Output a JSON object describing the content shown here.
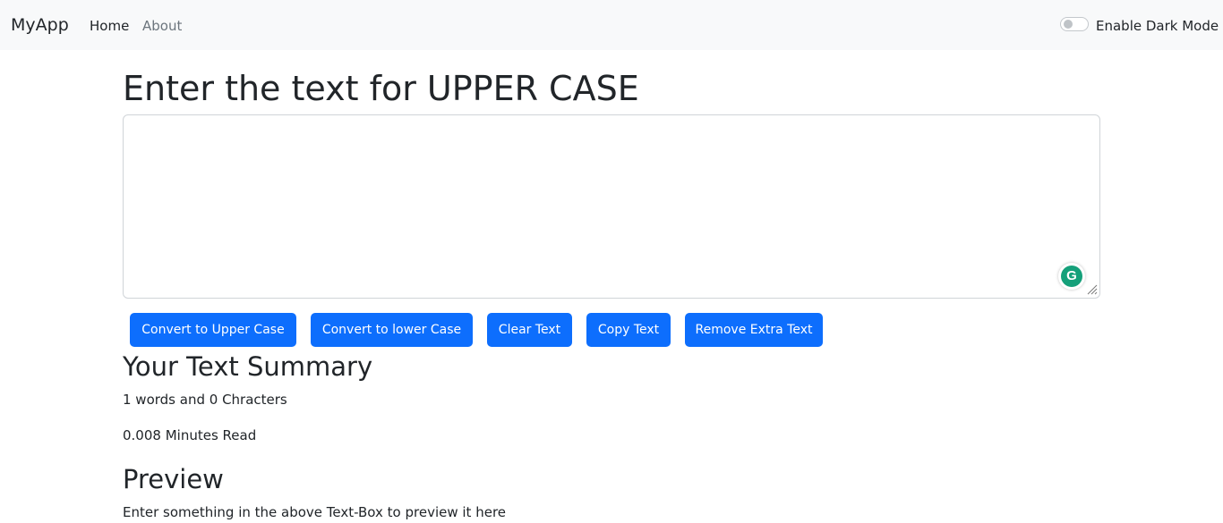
{
  "navbar": {
    "brand": "MyApp",
    "links": [
      {
        "label": "Home",
        "active": true
      },
      {
        "label": "About",
        "active": false
      }
    ],
    "dark_mode_toggle": {
      "label": "Enable Dark Mode",
      "checked": false
    }
  },
  "main": {
    "heading": "Enter the text for UPPER CASE",
    "textarea": {
      "value": "",
      "placeholder": ""
    },
    "buttons": [
      {
        "label": "Convert to Upper Case"
      },
      {
        "label": "Convert to lower Case"
      },
      {
        "label": "Clear Text"
      },
      {
        "label": "Copy Text"
      },
      {
        "label": "Remove Extra Text"
      }
    ],
    "summary": {
      "title": "Your Text Summary",
      "words_line": "1 words and 0 Chracters",
      "read_line": "0.008 Minutes Read"
    },
    "preview": {
      "title": "Preview",
      "text": "Enter something in the above Text-Box to preview it here"
    }
  },
  "colors": {
    "navbar_bg": "#f8f9fa",
    "primary_button": "#0d6efd",
    "grammarly_badge": "#15a07a"
  },
  "icons": {
    "grammarly": "grammarly-g-icon",
    "resize": "resize-grip-icon"
  }
}
